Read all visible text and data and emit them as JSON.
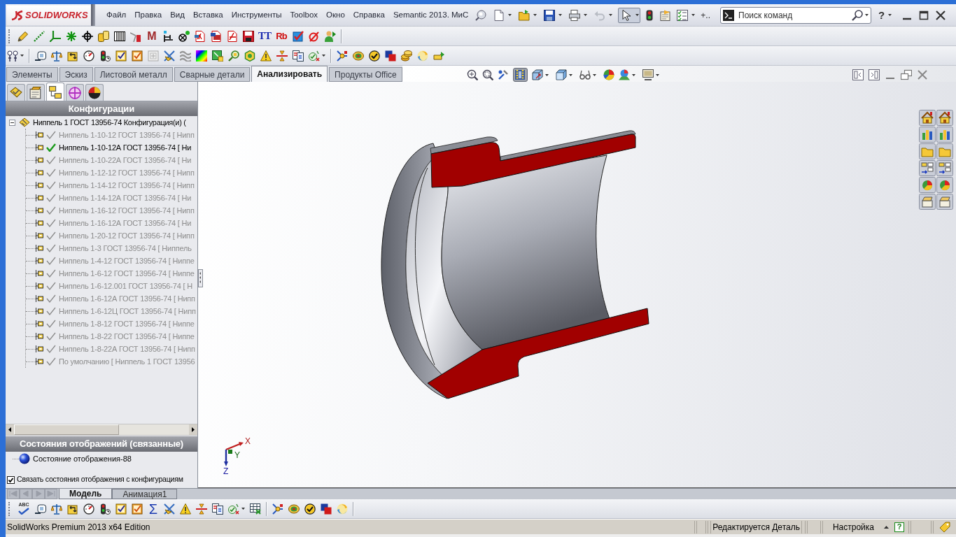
{
  "title_bar": {
    "logo": "SOLIDWORKS",
    "menu": [
      "Файл",
      "Правка",
      "Вид",
      "Вставка",
      "Инструменты",
      "Toolbox",
      "Окно",
      "Справка",
      "Semantic 2013. МиС"
    ]
  },
  "quick_access": {
    "select_tool": {
      "on": true
    },
    "overflow": "+..",
    "search": {
      "placeholder": "Поиск команд"
    },
    "help": "?"
  },
  "toolbar": {
    "glyphs": [
      "M",
      "TT",
      "Rb"
    ]
  },
  "command_tabs": [
    {
      "label": "Элементы",
      "selected": false
    },
    {
      "label": "Эскиз",
      "selected": false
    },
    {
      "label": "Листовой металл",
      "selected": false
    },
    {
      "label": "Сварные детали",
      "selected": false
    },
    {
      "label": "Анализировать",
      "selected": true
    },
    {
      "label": "Продукты Office",
      "selected": false
    }
  ],
  "view_toolbar": {
    "section_view": {
      "on": true
    }
  },
  "manager_panel": {
    "tabs": [
      {
        "selected": false
      },
      {
        "selected": false
      },
      {
        "selected": true
      },
      {
        "selected": false
      },
      {
        "selected": false
      }
    ],
    "title": "Конфигурации",
    "tree": {
      "label": "Ниппель 1 ГОСТ 13956-74 Конфигурация(и) (",
      "expanded": true,
      "children": [
        {
          "label": "Ниппель 1-10-12 ГОСТ 13956-74 [ Нипп",
          "active": false
        },
        {
          "label": "Ниппель 1-10-12А ГОСТ 13956-74 [ Ни",
          "active": true
        },
        {
          "label": "Ниппель 1-10-22А ГОСТ 13956-74 [ Ни",
          "active": false
        },
        {
          "label": "Ниппель 1-12-12 ГОСТ 13956-74 [ Нипп",
          "active": false
        },
        {
          "label": "Ниппель 1-14-12 ГОСТ 13956-74 [ Нипп",
          "active": false
        },
        {
          "label": "Ниппель 1-14-12А ГОСТ 13956-74 [ Ни",
          "active": false
        },
        {
          "label": "Ниппель 1-16-12 ГОСТ 13956-74 [ Нипп",
          "active": false
        },
        {
          "label": "Ниппель 1-16-12А ГОСТ 13956-74 [ Ни",
          "active": false
        },
        {
          "label": "Ниппель 1-20-12 ГОСТ 13956-74 [ Нипп",
          "active": false
        },
        {
          "label": "Ниппель 1-3 ГОСТ 13956-74 [ Ниппель",
          "active": false
        },
        {
          "label": "Ниппель 1-4-12 ГОСТ 13956-74 [ Ниппе",
          "active": false
        },
        {
          "label": "Ниппель 1-6-12 ГОСТ 13956-74 [ Ниппе",
          "active": false
        },
        {
          "label": "Ниппель 1-6-12.001 ГОСТ 13956-74 [ Н",
          "active": false
        },
        {
          "label": "Ниппель 1-6-12А ГОСТ 13956-74 [ Нипп",
          "active": false
        },
        {
          "label": "Ниппель 1-6-12Ц ГОСТ 13956-74 [ Нипп",
          "active": false
        },
        {
          "label": "Ниппель 1-8-12 ГОСТ 13956-74 [ Ниппе",
          "active": false
        },
        {
          "label": "Ниппель 1-8-22 ГОСТ 13956-74 [ Ниппе",
          "active": false
        },
        {
          "label": "Ниппель 1-8-22А ГОСТ 13956-74 [ Нипп",
          "active": false
        },
        {
          "label": "По умолчанию [ Ниппель 1 ГОСТ 13956",
          "active": false
        }
      ]
    },
    "display_states": {
      "title": "Состояния отображений (связанные)",
      "items": [
        "Состояние отображения-88"
      ]
    },
    "link_states": {
      "label": "Связать состояния отображения с конфигурациям",
      "checked": true
    }
  },
  "triad": {
    "x": "X",
    "y": "Y",
    "z": "Z"
  },
  "bottom_tabs": [
    {
      "label": "Модель",
      "selected": true
    },
    {
      "label": "Анимация1",
      "selected": false
    }
  ],
  "bottom_toolbar": {
    "glyphs": [
      "ABC",
      "Σ"
    ]
  },
  "status_bar": {
    "product": "SolidWorks Premium 2013 x64 Edition",
    "mode": "Редактируется Деталь",
    "units": "Настройка",
    "help": "?"
  }
}
